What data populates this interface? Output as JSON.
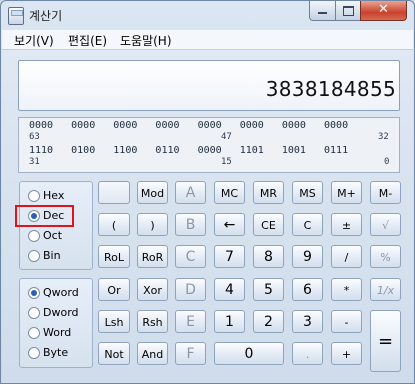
{
  "window": {
    "title": "계산기"
  },
  "menu": {
    "items": [
      "보기(V)",
      "편집(E)",
      "도움말(H)"
    ]
  },
  "display": {
    "value": "3838184855"
  },
  "bits": {
    "row1": "0000   0000   0000   0000   0000   0000   0000   0000",
    "row1_pos": [
      "63",
      "47",
      "32"
    ],
    "row2": "1110   0100   1100   0110   0000   1101   1001   0111",
    "row2_pos": [
      "31",
      "15",
      "0"
    ]
  },
  "base_options": [
    {
      "label": "Hex",
      "selected": false
    },
    {
      "label": "Dec",
      "selected": true
    },
    {
      "label": "Oct",
      "selected": false
    },
    {
      "label": "Bin",
      "selected": false
    }
  ],
  "word_options": [
    {
      "label": "Qword",
      "selected": true
    },
    {
      "label": "Dword",
      "selected": false
    },
    {
      "label": "Word",
      "selected": false
    },
    {
      "label": "Byte",
      "selected": false
    }
  ],
  "buttons": {
    "r1": [
      "",
      "Mod",
      "A",
      "MC",
      "MR",
      "MS",
      "M+",
      "M-"
    ],
    "r2": [
      "(",
      ")",
      "B",
      "←",
      "CE",
      "C",
      "±",
      "√"
    ],
    "r3": [
      "RoL",
      "RoR",
      "C",
      "7",
      "8",
      "9",
      "/",
      "%"
    ],
    "r4": [
      "Or",
      "Xor",
      "D",
      "4",
      "5",
      "6",
      "*",
      "1/x"
    ],
    "r5": [
      "Lsh",
      "Rsh",
      "E",
      "1",
      "2",
      "3",
      "-",
      "="
    ],
    "r6": [
      "Not",
      "And",
      "F",
      "0",
      ".",
      "+"
    ]
  }
}
